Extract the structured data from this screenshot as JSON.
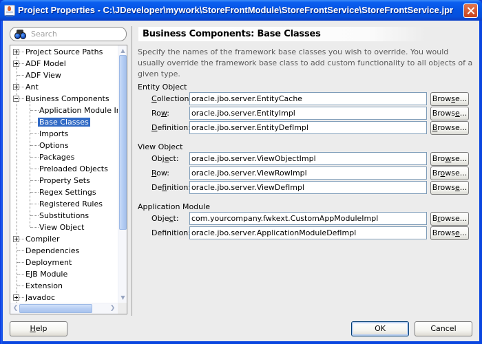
{
  "window": {
    "title": "Project Properties - C:\\JDeveloper\\mywork\\StoreFrontModule\\StoreFrontService\\StoreFrontService.jpr",
    "close_label": "Close"
  },
  "search": {
    "placeholder": "Search",
    "value": ""
  },
  "tree": {
    "items": [
      {
        "label": "Project Source Paths",
        "level": 0,
        "expander": "plus"
      },
      {
        "label": "ADF Model",
        "level": 0,
        "expander": "plus"
      },
      {
        "label": "ADF View",
        "level": 0,
        "expander": "none"
      },
      {
        "label": "Ant",
        "level": 0,
        "expander": "plus"
      },
      {
        "label": "Business Components",
        "level": 0,
        "expander": "minus"
      },
      {
        "label": "Application Module Inst",
        "level": 1,
        "expander": "none"
      },
      {
        "label": "Base Classes",
        "level": 1,
        "expander": "none",
        "selected": true
      },
      {
        "label": "Imports",
        "level": 1,
        "expander": "none"
      },
      {
        "label": "Options",
        "level": 1,
        "expander": "none"
      },
      {
        "label": "Packages",
        "level": 1,
        "expander": "none"
      },
      {
        "label": "Preloaded Objects",
        "level": 1,
        "expander": "none"
      },
      {
        "label": "Property Sets",
        "level": 1,
        "expander": "none"
      },
      {
        "label": "Regex Settings",
        "level": 1,
        "expander": "none"
      },
      {
        "label": "Registered Rules",
        "level": 1,
        "expander": "none"
      },
      {
        "label": "Substitutions",
        "level": 1,
        "expander": "none"
      },
      {
        "label": "View Object",
        "level": 1,
        "expander": "none"
      },
      {
        "label": "Compiler",
        "level": 0,
        "expander": "plus"
      },
      {
        "label": "Dependencies",
        "level": 0,
        "expander": "none"
      },
      {
        "label": "Deployment",
        "level": 0,
        "expander": "none"
      },
      {
        "label": "EJB Module",
        "level": 0,
        "expander": "none"
      },
      {
        "label": "Extension",
        "level": 0,
        "expander": "none"
      },
      {
        "label": "Javadoc",
        "level": 0,
        "expander": "plus"
      }
    ]
  },
  "page": {
    "title": "Business Components: Base Classes",
    "description": "Specify the names of the framework base classes you wish to override. You would usually override the framework base class to add custom functionality to all objects of a given type.",
    "groups": [
      {
        "label": "Entity Object",
        "fields": [
          {
            "label": "Collection:",
            "mnemonic_index": 0,
            "value": "oracle.jbo.server.EntityCache",
            "browse_label": "Browse...",
            "browse_mnemonic_index": 4
          },
          {
            "label": "Row:",
            "mnemonic_index": 2,
            "value": "oracle.jbo.server.EntityImpl",
            "browse_label": "Browse...",
            "browse_mnemonic_index": 5
          },
          {
            "label": "Definition:",
            "mnemonic_index": 0,
            "value": "oracle.jbo.server.EntityDefImpl",
            "browse_label": "Browse...",
            "browse_mnemonic_index": 0
          }
        ]
      },
      {
        "label": "View Object",
        "fields": [
          {
            "label": "Object:",
            "mnemonic_index": 3,
            "value": "oracle.jbo.server.ViewObjectImpl",
            "browse_label": "Browse...",
            "browse_mnemonic_index": 3
          },
          {
            "label": "Row:",
            "mnemonic_index": 0,
            "value": "oracle.jbo.server.ViewRowImpl",
            "browse_label": "Browse...",
            "browse_mnemonic_index": 2
          },
          {
            "label": "Definition:",
            "mnemonic_index": 2,
            "value": "oracle.jbo.server.ViewDefImpl",
            "browse_label": "Browse...",
            "browse_mnemonic_index": 5
          }
        ]
      },
      {
        "label": "Application Module",
        "fields": [
          {
            "label": "Object:",
            "mnemonic_index": 4,
            "value": "com.yourcompany.fwkext.CustomAppModuleImpl",
            "browse_label": "Browse...",
            "browse_mnemonic_index": 1
          },
          {
            "label": "Definition:",
            "mnemonic_index": 3,
            "value": "oracle.jbo.server.ApplicationModuleDefImpl",
            "browse_label": "Browse...",
            "browse_mnemonic_index": 5
          }
        ]
      }
    ]
  },
  "buttons": {
    "help": "Help",
    "ok": "OK",
    "cancel": "Cancel"
  },
  "colors": {
    "titlebar": "#0554e3",
    "selection": "#316ac5",
    "dialog_bg": "#ececec",
    "input_border": "#7f9db9"
  }
}
